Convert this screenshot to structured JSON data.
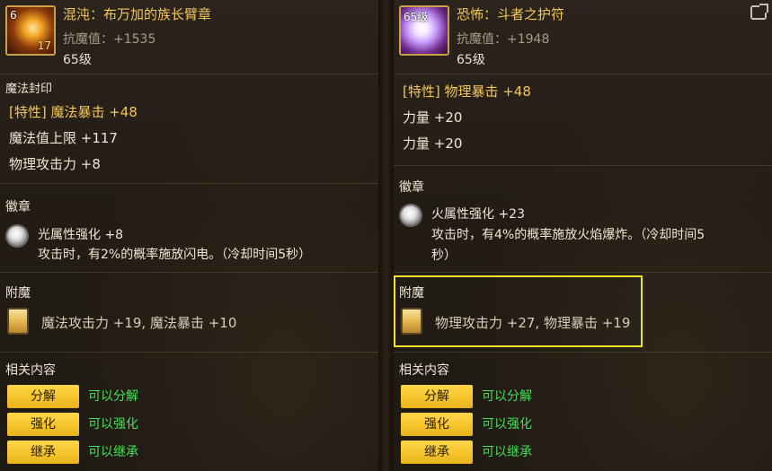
{
  "left": {
    "item": {
      "badge_top": "6",
      "badge_bottom": "17",
      "title": "混沌：布万加的族长臂章",
      "anti_magic": "抗魔值：+1535",
      "level": "65级"
    },
    "seal_section_title": "魔法封印",
    "seal_stats": [
      "[特性] 魔法暴击 +48",
      "魔法值上限 +117",
      "物理攻击力 +8"
    ],
    "emblem_section_title": "徽章",
    "emblem_lines": [
      "光属性强化 +8",
      "攻击时，有2%的概率施放闪电。（冷却时间5秒）"
    ],
    "enchant_section_title": "附魔",
    "enchant_text": "魔法攻击力 +19, 魔法暴击 +10",
    "related_title": "相关内容",
    "related": [
      {
        "button": "分解",
        "status": "可以分解"
      },
      {
        "button": "强化",
        "status": "可以强化"
      },
      {
        "button": "继承",
        "status": "可以继承"
      }
    ]
  },
  "right": {
    "item": {
      "badge_level": "65级",
      "title": "恐怖：斗者之护符",
      "anti_magic": "抗魔值：+1948",
      "level": "65级"
    },
    "stats": [
      "[特性] 物理暴击 +48",
      "力量 +20",
      "力量 +20"
    ],
    "emblem_section_title": "徽章",
    "emblem_lines": [
      "火属性强化 +23",
      "攻击时，有4%的概率施放火焰爆炸。（冷却时间5",
      "秒）"
    ],
    "enchant_section_title": "附魔",
    "enchant_text": "物理攻击力 +27, 物理暴击 +19",
    "related_title": "相关内容",
    "related": [
      {
        "button": "分解",
        "status": "可以分解"
      },
      {
        "button": "强化",
        "status": "可以强化"
      },
      {
        "button": "继承",
        "status": "可以继承"
      }
    ]
  },
  "colors": {
    "accent_gold": "#f3c65a",
    "button_yellow": "#f5c52a",
    "status_green": "#47e05a",
    "highlight_yellow": "#f2e229"
  }
}
